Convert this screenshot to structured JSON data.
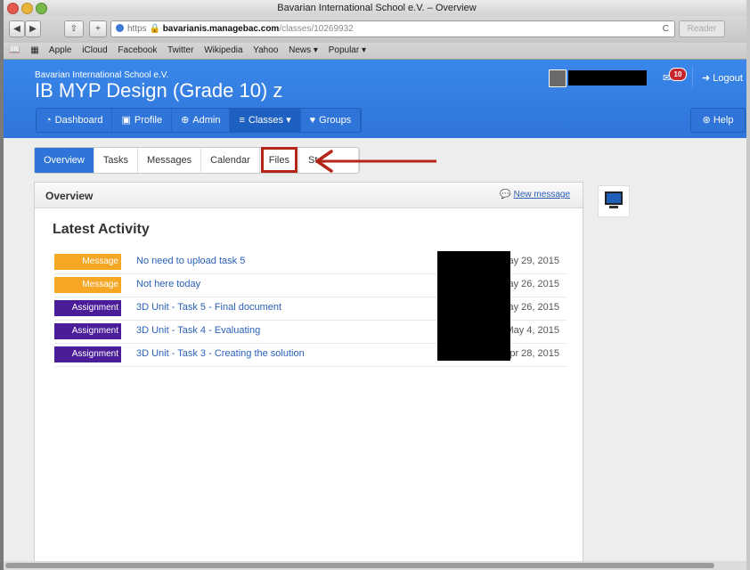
{
  "window": {
    "title": "Bavarian International School e.V. – Overview"
  },
  "toolbar": {
    "back": "◀",
    "forward": "▶",
    "share": "⇧",
    "add": "+",
    "url_scheme": "https",
    "url_host": "bavarianis.managebac.com",
    "url_path": "/classes/10269932",
    "reload": "C",
    "reader": "Reader"
  },
  "bookmarks": [
    "Apple",
    "iCloud",
    "Facebook",
    "Twitter",
    "Wikipedia",
    "Yahoo",
    "News ▾",
    "Popular ▾"
  ],
  "header": {
    "school": "Bavarian International School e.V.",
    "class_title": "IB MYP Design (Grade 10) z",
    "notification_count": "10",
    "logout": "Logout",
    "help": "Help",
    "nav": [
      {
        "label": "Dashboard",
        "icon": "◔"
      },
      {
        "label": "Profile",
        "icon": "▣"
      },
      {
        "label": "Admin",
        "icon": "⊕"
      },
      {
        "label": "Classes",
        "icon": "≡"
      },
      {
        "label": "Groups",
        "icon": "♥"
      }
    ]
  },
  "tabs": [
    "Overview",
    "Tasks",
    "Messages",
    "Calendar",
    "Files",
    "St..."
  ],
  "overview": {
    "title": "Overview",
    "new_message": "New message",
    "latest_activity": "Latest Activity",
    "rows": [
      {
        "type": "Message",
        "title": "No need to upload task 5",
        "date": "May 29, 2015"
      },
      {
        "type": "Message",
        "title": "Not here today",
        "date": "May 26, 2015"
      },
      {
        "type": "Assignment",
        "title": "3D Unit - Task 5 - Final document",
        "date": "May 26, 2015"
      },
      {
        "type": "Assignment",
        "title": "3D Unit - Task 4 - Evaluating",
        "date": "May 4, 2015"
      },
      {
        "type": "Assignment",
        "title": "3D Unit - Task 3 - Creating the solution",
        "date": "Apr 28, 2015"
      }
    ]
  },
  "colors": {
    "brand_blue": "#2f74d9",
    "message_tag": "#f5a623",
    "assignment_tag": "#4b1d99",
    "annotation_red": "#b5261a"
  }
}
